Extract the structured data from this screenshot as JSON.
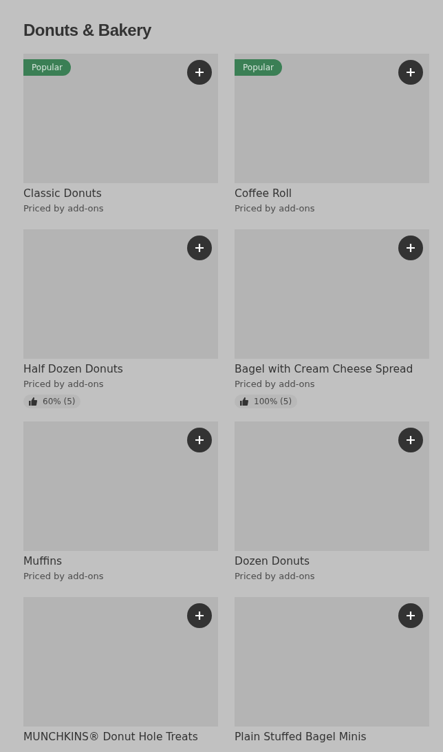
{
  "section": {
    "title": "Donuts & Bakery"
  },
  "items": [
    {
      "name": "Classic Donuts",
      "price": "Priced by add-ons",
      "popular": true,
      "badge": "Popular"
    },
    {
      "name": "Coffee Roll",
      "price": "Priced by add-ons",
      "popular": true,
      "badge": "Popular"
    },
    {
      "name": "Half Dozen Donuts",
      "price": "Priced by add-ons",
      "popular": false,
      "rating": "60% (5)"
    },
    {
      "name": "Bagel with Cream Cheese Spread",
      "price": "Priced by add-ons",
      "popular": false,
      "rating": "100% (5)"
    },
    {
      "name": "Muffins",
      "price": "Priced by add-ons",
      "popular": false
    },
    {
      "name": "Dozen Donuts",
      "price": "Priced by add-ons",
      "popular": false
    },
    {
      "name": "MUNCHKINS® Donut Hole Treats",
      "popular": false
    },
    {
      "name": "Plain Stuffed Bagel Minis",
      "popular": false
    }
  ]
}
